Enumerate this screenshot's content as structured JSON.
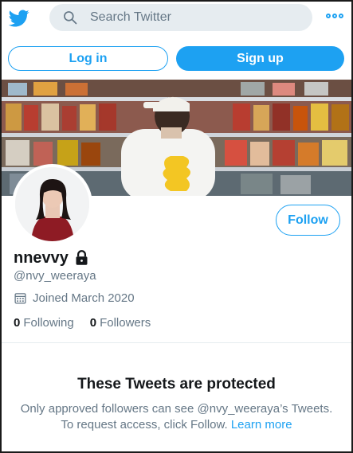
{
  "search": {
    "placeholder": "Search Twitter"
  },
  "auth": {
    "login_label": "Log in",
    "signup_label": "Sign up"
  },
  "profile": {
    "display_name": "nnevvy",
    "handle": "@nvy_weeraya",
    "joined": "Joined March 2020",
    "following_count": "0",
    "following_label": "Following",
    "followers_count": "0",
    "followers_label": "Followers",
    "follow_label": "Follow"
  },
  "protected": {
    "title": "These Tweets are protected",
    "line1": "Only approved followers can see @nvy_weeraya’s Tweets.",
    "line2_prefix": "To request access, click Follow.",
    "learn_more": "Learn more"
  },
  "colors": {
    "brand": "#1da1f2",
    "text": "#14171a",
    "muted": "#657786"
  },
  "icons": [
    "twitter-bird-icon",
    "search-icon",
    "more-icon",
    "lock-icon",
    "calendar-icon"
  ]
}
